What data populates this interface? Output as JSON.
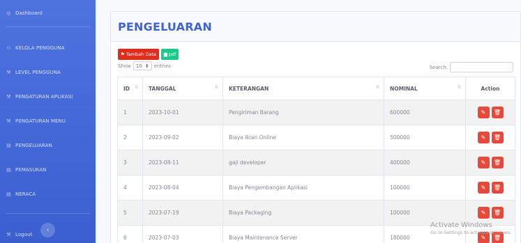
{
  "sidebar": {
    "brand": "Dashboard",
    "items": [
      {
        "label": "KELOLA PENGGUNA",
        "icon": "users-icon"
      },
      {
        "label": "LEVEL PENGGUNA",
        "icon": "wrench-icon"
      },
      {
        "label": "PENGATURAN APLIKASI",
        "icon": "wrench-icon"
      },
      {
        "label": "PENGATURAN MENU",
        "icon": "wrench-icon"
      },
      {
        "label": "PENGELUARAN",
        "icon": "table-icon"
      },
      {
        "label": "PEMASUKAN",
        "icon": "table-icon"
      },
      {
        "label": "NERACA",
        "icon": "table-icon"
      }
    ],
    "logout": "Logout",
    "toggle": "‹"
  },
  "page": {
    "title": "PENGELUARAN",
    "add_button": "Tambah Data",
    "pdf_button": "pdf",
    "show_label": "Show",
    "entries_value": "10",
    "entries_label": "entries",
    "search_label": "Search:"
  },
  "table": {
    "headers": [
      "ID",
      "TANGGAL",
      "KETERANGAN",
      "NOMINAL",
      "Action"
    ],
    "rows": [
      {
        "id": "1",
        "tanggal": "2023-10-01",
        "keterangan": "Pengiriman Barang",
        "nominal": "600000"
      },
      {
        "id": "2",
        "tanggal": "2023-09-02",
        "keterangan": "Biaya Iklan Online",
        "nominal": "500000"
      },
      {
        "id": "3",
        "tanggal": "2023-08-11",
        "keterangan": "gaji developer",
        "nominal": "400000"
      },
      {
        "id": "4",
        "tanggal": "2023-08-04",
        "keterangan": "Biaya Pengembangan Aplikasi",
        "nominal": "100000"
      },
      {
        "id": "5",
        "tanggal": "2023-07-19",
        "keterangan": "Biaya Packaging",
        "nominal": "100000"
      },
      {
        "id": "6",
        "tanggal": "2023-07-03",
        "keterangan": "Biaya Maintenance Server",
        "nominal": "180000"
      }
    ]
  },
  "watermark": {
    "line1": "Activate Windows",
    "line2": "Go to Settings to activate Windows."
  },
  "colors": {
    "sidebar": "#4e73df",
    "title": "#3f63cf",
    "danger": "#e74a3b",
    "success": "#1cc88a"
  }
}
